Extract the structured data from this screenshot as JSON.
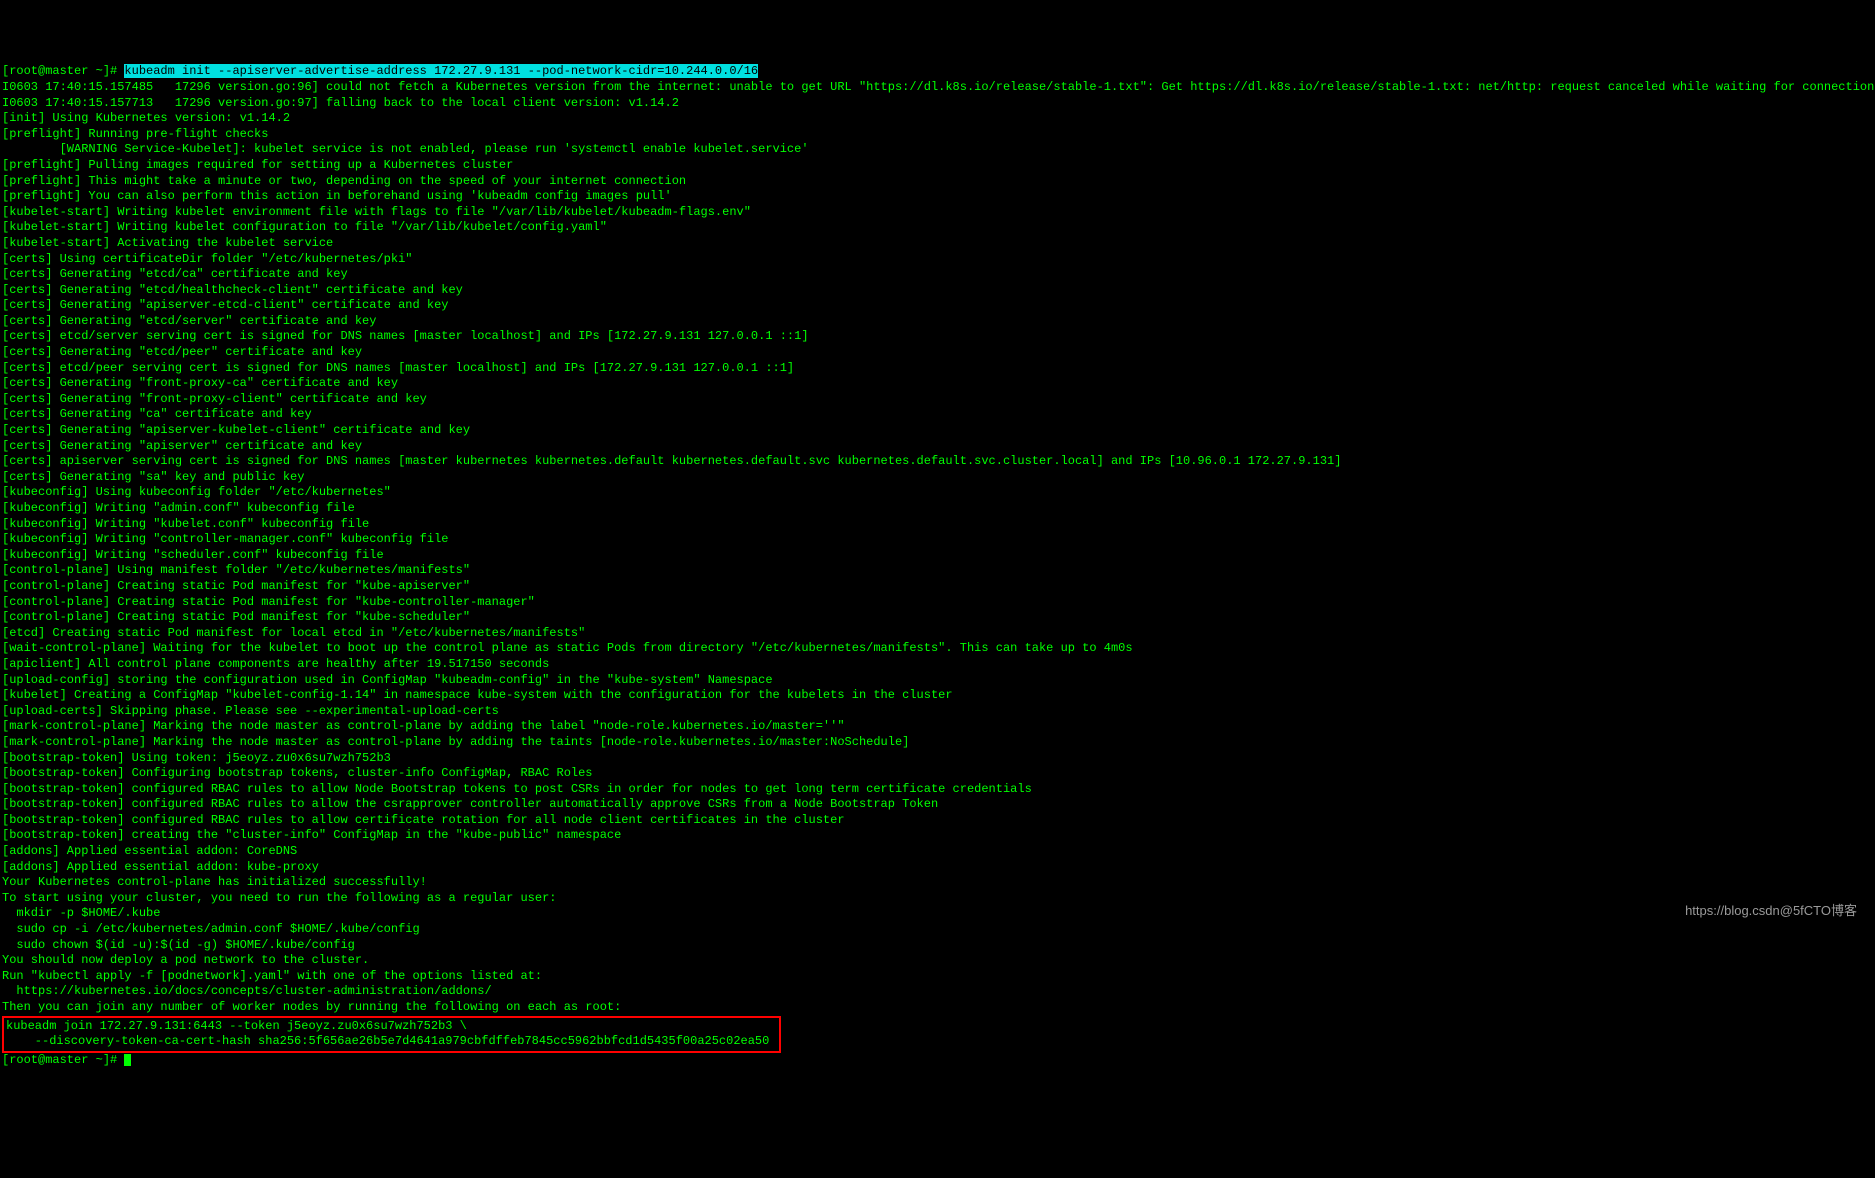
{
  "prompt1_prefix": "[root@master ~]# ",
  "prompt1_cmd": "kubeadm init --apiserver-advertise-address 172.27.9.131 --pod-network-cidr=10.244.0.0/16",
  "output_lines": [
    "I0603 17:40:15.157485   17296 version.go:96] could not fetch a Kubernetes version from the internet: unable to get URL \"https://dl.k8s.io/release/stable-1.txt\": Get https://dl.k8s.io/release/stable-1.txt: net/http: request canceled while waiting for connection (Client.Timeout exceeded while awaiting headers)",
    "I0603 17:40:15.157713   17296 version.go:97] falling back to the local client version: v1.14.2",
    "[init] Using Kubernetes version: v1.14.2",
    "[preflight] Running pre-flight checks",
    "        [WARNING Service-Kubelet]: kubelet service is not enabled, please run 'systemctl enable kubelet.service'",
    "[preflight] Pulling images required for setting up a Kubernetes cluster",
    "[preflight] This might take a minute or two, depending on the speed of your internet connection",
    "[preflight] You can also perform this action in beforehand using 'kubeadm config images pull'",
    "[kubelet-start] Writing kubelet environment file with flags to file \"/var/lib/kubelet/kubeadm-flags.env\"",
    "[kubelet-start] Writing kubelet configuration to file \"/var/lib/kubelet/config.yaml\"",
    "[kubelet-start] Activating the kubelet service",
    "[certs] Using certificateDir folder \"/etc/kubernetes/pki\"",
    "[certs] Generating \"etcd/ca\" certificate and key",
    "[certs] Generating \"etcd/healthcheck-client\" certificate and key",
    "[certs] Generating \"apiserver-etcd-client\" certificate and key",
    "[certs] Generating \"etcd/server\" certificate and key",
    "[certs] etcd/server serving cert is signed for DNS names [master localhost] and IPs [172.27.9.131 127.0.0.1 ::1]",
    "[certs] Generating \"etcd/peer\" certificate and key",
    "[certs] etcd/peer serving cert is signed for DNS names [master localhost] and IPs [172.27.9.131 127.0.0.1 ::1]",
    "[certs] Generating \"front-proxy-ca\" certificate and key",
    "[certs] Generating \"front-proxy-client\" certificate and key",
    "[certs] Generating \"ca\" certificate and key",
    "[certs] Generating \"apiserver-kubelet-client\" certificate and key",
    "[certs] Generating \"apiserver\" certificate and key",
    "[certs] apiserver serving cert is signed for DNS names [master kubernetes kubernetes.default kubernetes.default.svc kubernetes.default.svc.cluster.local] and IPs [10.96.0.1 172.27.9.131]",
    "[certs] Generating \"sa\" key and public key",
    "[kubeconfig] Using kubeconfig folder \"/etc/kubernetes\"",
    "[kubeconfig] Writing \"admin.conf\" kubeconfig file",
    "[kubeconfig] Writing \"kubelet.conf\" kubeconfig file",
    "[kubeconfig] Writing \"controller-manager.conf\" kubeconfig file",
    "[kubeconfig] Writing \"scheduler.conf\" kubeconfig file",
    "[control-plane] Using manifest folder \"/etc/kubernetes/manifests\"",
    "[control-plane] Creating static Pod manifest for \"kube-apiserver\"",
    "[control-plane] Creating static Pod manifest for \"kube-controller-manager\"",
    "[control-plane] Creating static Pod manifest for \"kube-scheduler\"",
    "[etcd] Creating static Pod manifest for local etcd in \"/etc/kubernetes/manifests\"",
    "[wait-control-plane] Waiting for the kubelet to boot up the control plane as static Pods from directory \"/etc/kubernetes/manifests\". This can take up to 4m0s",
    "[apiclient] All control plane components are healthy after 19.517150 seconds",
    "[upload-config] storing the configuration used in ConfigMap \"kubeadm-config\" in the \"kube-system\" Namespace",
    "[kubelet] Creating a ConfigMap \"kubelet-config-1.14\" in namespace kube-system with the configuration for the kubelets in the cluster",
    "[upload-certs] Skipping phase. Please see --experimental-upload-certs",
    "[mark-control-plane] Marking the node master as control-plane by adding the label \"node-role.kubernetes.io/master=''\"",
    "[mark-control-plane] Marking the node master as control-plane by adding the taints [node-role.kubernetes.io/master:NoSchedule]",
    "[bootstrap-token] Using token: j5eoyz.zu0x6su7wzh752b3",
    "[bootstrap-token] Configuring bootstrap tokens, cluster-info ConfigMap, RBAC Roles",
    "[bootstrap-token] configured RBAC rules to allow Node Bootstrap tokens to post CSRs in order for nodes to get long term certificate credentials",
    "[bootstrap-token] configured RBAC rules to allow the csrapprover controller automatically approve CSRs from a Node Bootstrap Token",
    "[bootstrap-token] configured RBAC rules to allow certificate rotation for all node client certificates in the cluster",
    "[bootstrap-token] creating the \"cluster-info\" ConfigMap in the \"kube-public\" namespace",
    "[addons] Applied essential addon: CoreDNS",
    "[addons] Applied essential addon: kube-proxy",
    "",
    "Your Kubernetes control-plane has initialized successfully!",
    "",
    "To start using your cluster, you need to run the following as a regular user:",
    "",
    "  mkdir -p $HOME/.kube",
    "  sudo cp -i /etc/kubernetes/admin.conf $HOME/.kube/config",
    "  sudo chown $(id -u):$(id -g) $HOME/.kube/config",
    "",
    "You should now deploy a pod network to the cluster.",
    "Run \"kubectl apply -f [podnetwork].yaml\" with one of the options listed at:",
    "  https://kubernetes.io/docs/concepts/cluster-administration/addons/",
    "",
    "Then you can join any number of worker nodes by running the following on each as root:",
    ""
  ],
  "join_box_line1": "kubeadm join 172.27.9.131:6443 --token j5eoyz.zu0x6su7wzh752b3 \\",
  "join_box_line2": "    --discovery-token-ca-cert-hash sha256:5f656ae26b5e7d4641a979cbfdffeb7845cc5962bbfcd1d5435f00a25c02ea50 ",
  "prompt2": "[root@master ~]# ",
  "watermark": "https://blog.csdn@5fCTO博客"
}
